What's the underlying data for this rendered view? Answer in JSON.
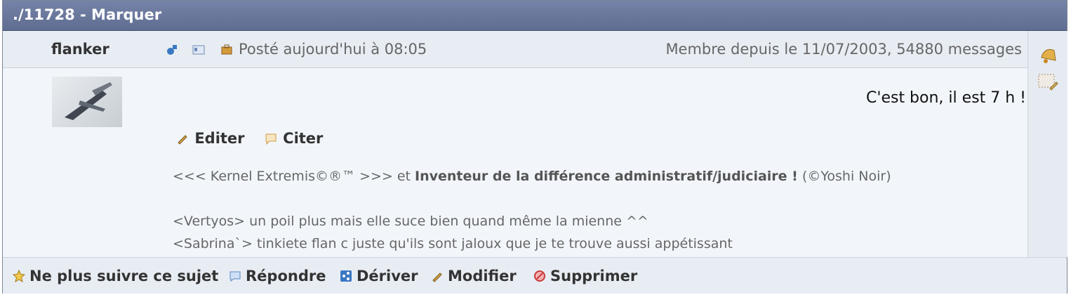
{
  "title": "./11728 - Marquer",
  "post": {
    "author": "flanker",
    "posted": "Posté aujourd'hui à 08:05",
    "member": "Membre depuis le 11/07/2003, 54880 messages",
    "message": "C'est bon, il est 7 h !",
    "edit_label": "Editer",
    "quote_label": "Citer",
    "sig_line1_a": "<<< Kernel Extremis©®™ >>> et",
    "sig_line1_b": "Inventeur de la différence administratif/judiciaire !",
    "sig_line1_c": "(©Yoshi Noir)",
    "sig_line2": "<Vertyos> un poil plus mais elle suce bien quand même la mienne ^^",
    "sig_line3": "<Sabrina`> tinkiete flan c juste qu'ils sont jaloux que je te trouve aussi appétissant"
  },
  "footer": {
    "follow": "Ne plus suivre ce sujet",
    "reply": "Répondre",
    "derive": "Dériver",
    "modify": "Modifier",
    "delete": "Supprimer"
  }
}
